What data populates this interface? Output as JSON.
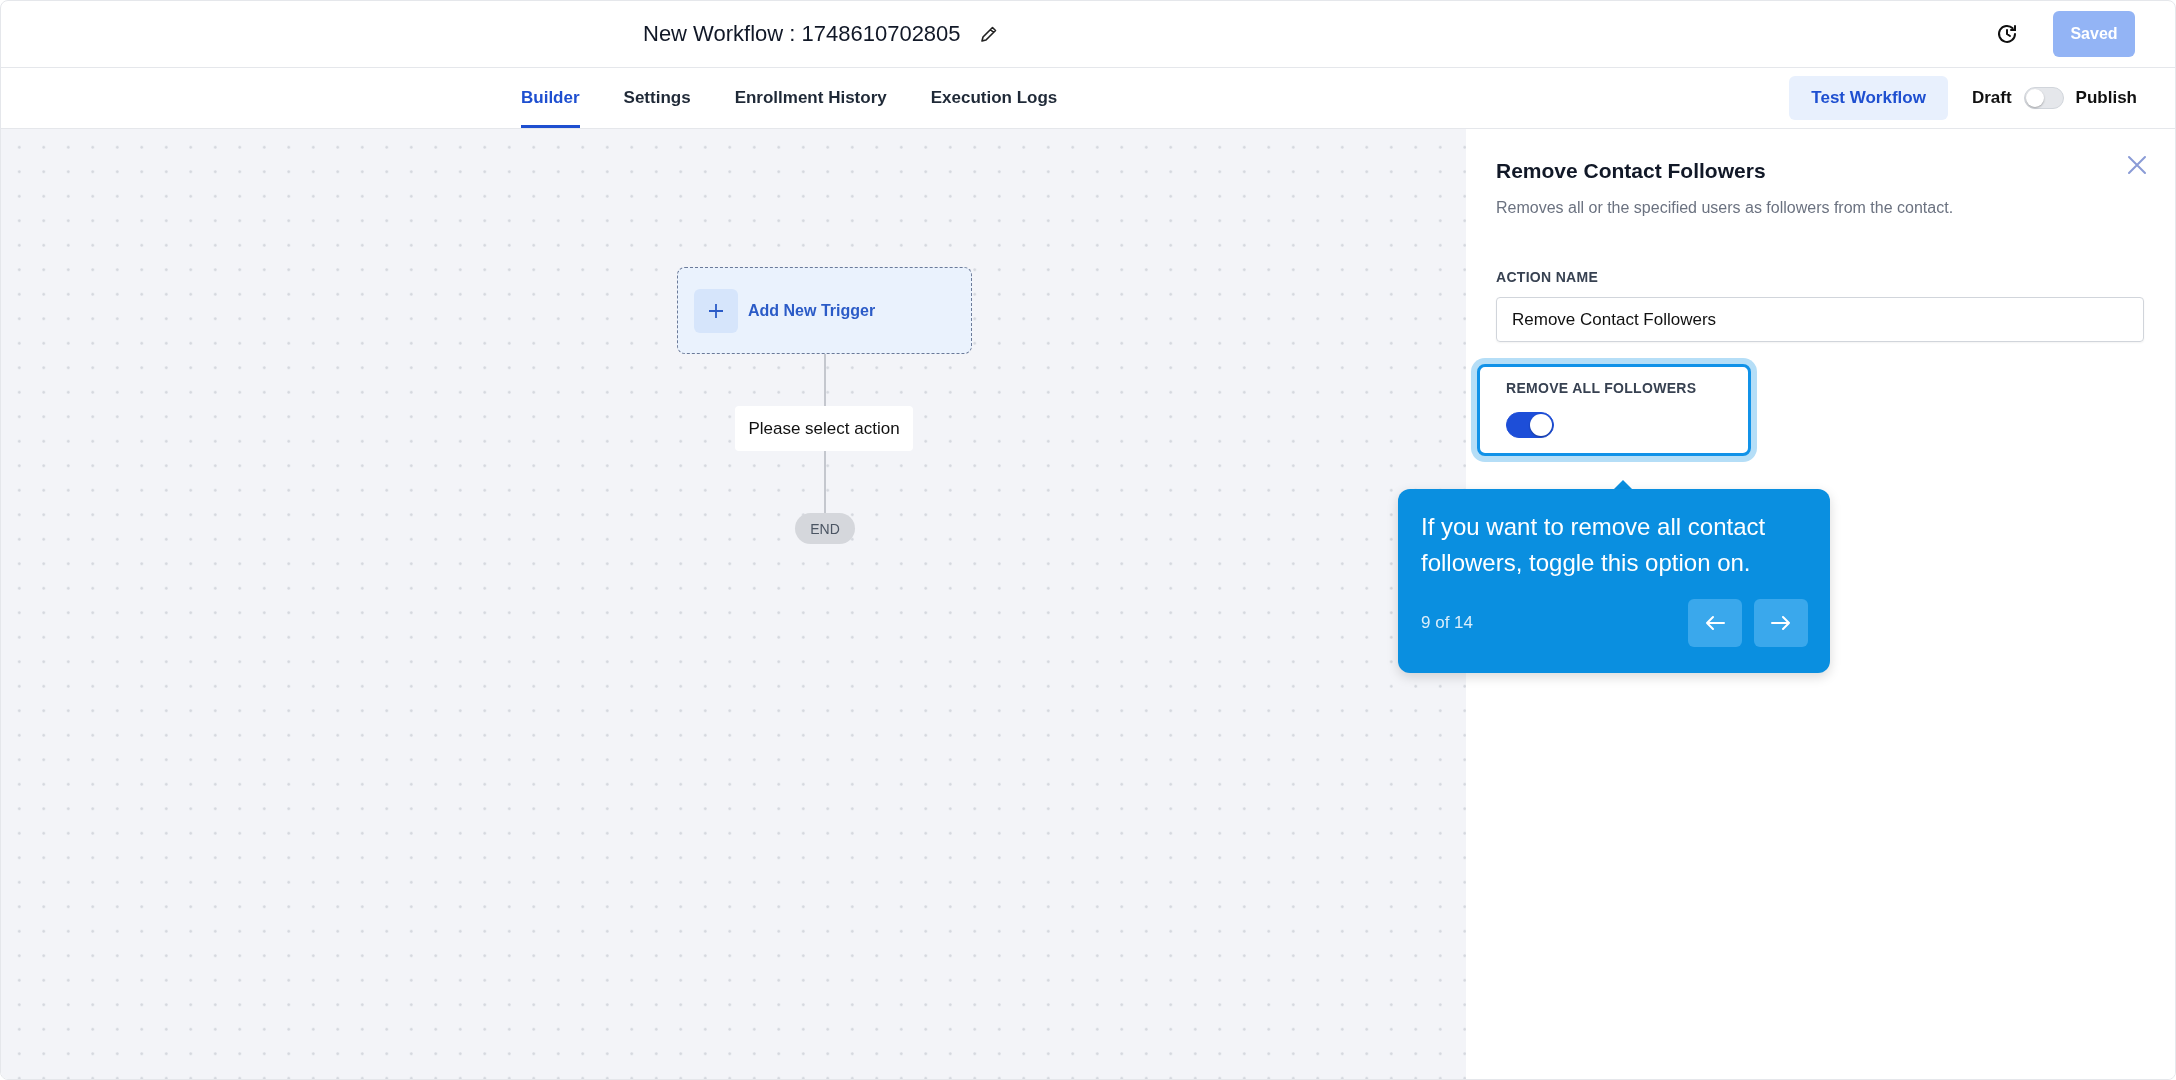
{
  "header": {
    "title": "New Workflow : 1748610702805",
    "save_button": {
      "label": "Saved",
      "disabled": true
    }
  },
  "tabs": [
    {
      "label": "Builder",
      "selected": true
    },
    {
      "label": "Settings",
      "selected": false
    },
    {
      "label": "Enrollment History",
      "selected": false
    },
    {
      "label": "Execution Logs",
      "selected": false
    }
  ],
  "toolbar": {
    "test_button": "Test Workflow",
    "draft_label": "Draft",
    "publish_label": "Publish",
    "publish_toggle": {
      "on": false
    }
  },
  "canvas": {
    "trigger": "Add New Trigger",
    "action": "Please select action",
    "end": "END"
  },
  "panel": {
    "title": "Remove Contact Followers",
    "description": "Removes all or the specified users as followers from the contact.",
    "action_name_label": "ACTION NAME",
    "action_name_value": "Remove Contact Followers",
    "remove_all_label": "REMOVE ALL FOLLOWERS",
    "remove_all_toggle": {
      "on": true
    }
  },
  "tooltip": {
    "text": "If you want to remove all contact followers, toggle this option on.",
    "step": "9 of 14"
  }
}
